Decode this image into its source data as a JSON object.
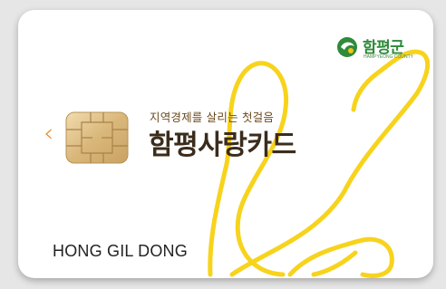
{
  "card": {
    "slogan": "지역경제를 살리는 첫걸음",
    "name": "함평사랑카드",
    "holder_name": "HONG GIL DONG",
    "prev_icon": "chevron-left-icon"
  },
  "issuer": {
    "name": "함평군",
    "subtitle": "HAMPYEONG COUNTY"
  },
  "colors": {
    "butterfly": "#f7d31c",
    "chevron": "#e38b2b",
    "title_brown": "#3b2c1c",
    "logo_green": "#2f8a3a"
  }
}
